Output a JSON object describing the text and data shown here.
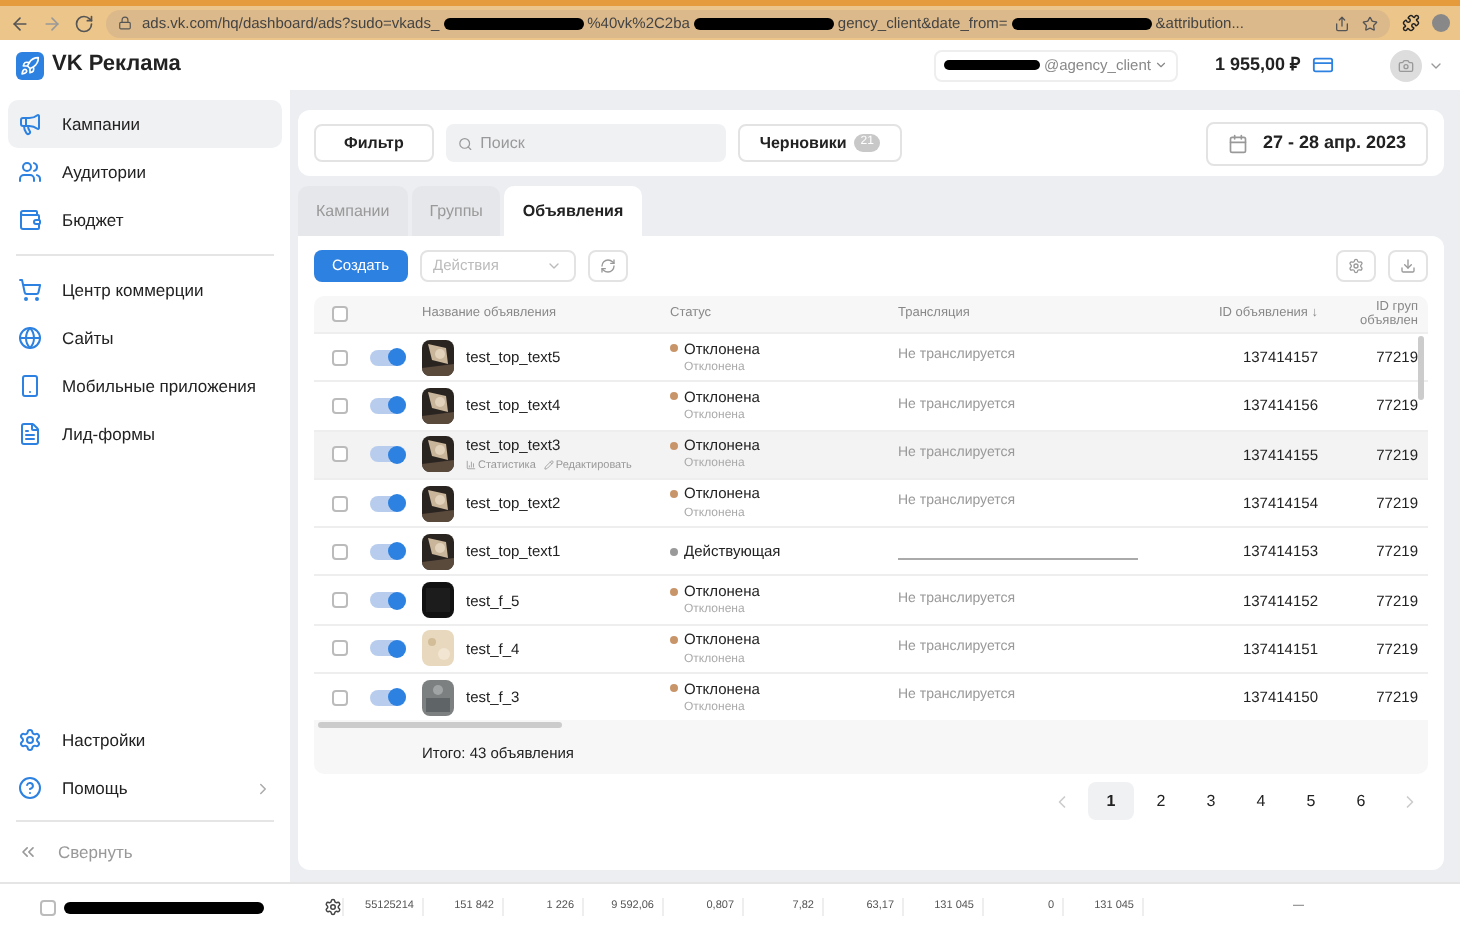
{
  "browser": {
    "url_parts": [
      {
        "kind": "text",
        "text": "ads.vk.com/hq/dashboard/ads?sudo=vkads_"
      },
      {
        "kind": "redacted"
      },
      {
        "kind": "text",
        "text": "%40vk%2C2ba"
      },
      {
        "kind": "redacted"
      },
      {
        "kind": "text",
        "text": "gency_client&date_from="
      },
      {
        "kind": "redacted"
      },
      {
        "kind": "text",
        "text": "&attribution..."
      }
    ]
  },
  "header": {
    "logo": "VK Реклама",
    "account": "@agency_client",
    "balance": "1 955,00 ₽"
  },
  "sidebar": {
    "items": [
      {
        "label": "Кампании",
        "selected": true
      },
      {
        "label": "Аудитории",
        "selected": false
      },
      {
        "label": "Бюджет",
        "selected": false
      },
      {
        "kind": "divider"
      },
      {
        "label": "Центр коммерции",
        "selected": false
      },
      {
        "label": "Сайты",
        "selected": false
      },
      {
        "label": "Мобильные приложения",
        "selected": false
      },
      {
        "label": "Лид-формы",
        "selected": false
      }
    ],
    "bottom": [
      {
        "label": "Настройки",
        "chevron": false
      },
      {
        "label": "Помощь",
        "chevron": true
      }
    ],
    "collapse": "Свернуть"
  },
  "filter_bar": {
    "filter": "Фильтр",
    "search_placeholder": "Поиск",
    "drafts": "Черновики",
    "drafts_count": "21",
    "date_range": "27 - 28 апр. 2023"
  },
  "tabs": [
    {
      "label": "Кампании",
      "selected": false
    },
    {
      "label": "Группы",
      "selected": false
    },
    {
      "label": "Объявления",
      "selected": true
    }
  ],
  "toolbar": {
    "create": "Создать",
    "actions": "Действия"
  },
  "table": {
    "select_all_checked": false,
    "columns": [
      "Название объявления",
      "Статус",
      "Трансляция",
      "ID объявления ↓",
      "ID груп объявлен"
    ],
    "rows": [
      {
        "name": "test_top_text5",
        "status": "Отклонена",
        "status_sub": "Отклонена",
        "color": "#c8956a",
        "broadcast": "Не транслируется",
        "id": "137414157",
        "group": "77219",
        "on": true,
        "checked": false,
        "hovered": false
      },
      {
        "name": "test_top_text4",
        "status": "Отклонена",
        "status_sub": "Отклонена",
        "color": "#c8956a",
        "broadcast": "Не транслируется",
        "id": "137414156",
        "group": "77219",
        "on": true,
        "checked": false,
        "hovered": false
      },
      {
        "name": "test_top_text3",
        "status": "Отклонена",
        "status_sub": "Отклонена",
        "color": "#c8956a",
        "broadcast": "Не транслируется",
        "id": "137414155",
        "group": "77219",
        "on": true,
        "checked": false,
        "hovered": true,
        "actions": [
          "Статистика",
          "Редактировать"
        ]
      },
      {
        "name": "test_top_text2",
        "status": "Отклонена",
        "status_sub": "Отклонена",
        "color": "#c8956a",
        "broadcast": "Не транслируется",
        "id": "137414154",
        "group": "77219",
        "on": true,
        "checked": false,
        "hovered": false
      },
      {
        "name": "test_top_text1",
        "status": "Действующая",
        "color": "#9a9a9a",
        "id": "137414153",
        "group": "77219",
        "on": true,
        "checked": false,
        "hovered": false
      },
      {
        "name": "test_f_5",
        "status": "Отклонена",
        "status_sub": "Отклонена",
        "color": "#c8956a",
        "broadcast": "Не транслируется",
        "id": "137414152",
        "group": "77219",
        "kind": "dark",
        "on": true,
        "checked": false,
        "hovered": false
      },
      {
        "name": "test_f_4",
        "status": "Отклонена",
        "status_sub": "Отклонена",
        "color": "#c8956a",
        "broadcast": "Не транслируется",
        "id": "137414151",
        "group": "77219",
        "kind": "beige",
        "on": true,
        "checked": false,
        "hovered": false
      },
      {
        "name": "test_f_3",
        "status": "Отклонена",
        "status_sub": "Отклонена",
        "color": "#c8956a",
        "broadcast": "Не транслируется",
        "id": "137414150",
        "group": "77219",
        "kind": "grey",
        "on": true,
        "checked": false,
        "hovered": false
      }
    ],
    "total": "Итого: 43 объявления"
  },
  "pagination": [
    {
      "label": "1",
      "selected": true
    },
    {
      "label": "2",
      "selected": false
    },
    {
      "label": "3",
      "selected": false
    },
    {
      "label": "4",
      "selected": false
    },
    {
      "label": "5",
      "selected": false
    },
    {
      "label": "6",
      "selected": false
    }
  ],
  "stats_row": [
    "55125214",
    "151 842",
    "1 226",
    "9 592,06",
    "0,807",
    "7,82",
    "63,17",
    "131 045",
    "0",
    "131 045",
    "—"
  ]
}
